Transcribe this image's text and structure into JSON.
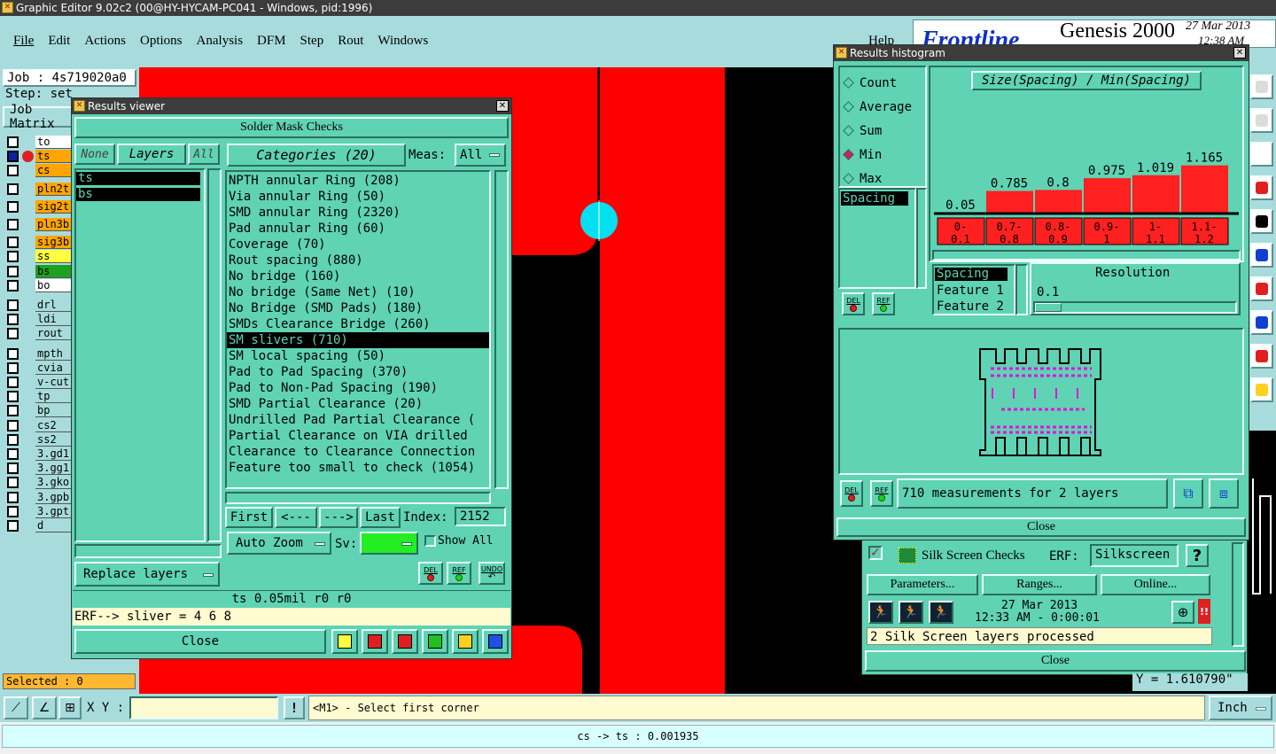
{
  "window": {
    "title": "Graphic Editor 9.02c2 (00@HY-HYCAM-PC041 - Windows, pid:1996)"
  },
  "menu": [
    "File",
    "Edit",
    "Actions",
    "Options",
    "Analysis",
    "DFM",
    "Step",
    "Rout",
    "Windows"
  ],
  "help_label": "Help",
  "brand": {
    "logo": "Frontline",
    "product": "Genesis 2000",
    "date": "27 Mar 2013",
    "time": "12:38 AM"
  },
  "job": {
    "job": "Job : 4s719020a0",
    "step": "Step: set",
    "matrix": "Job Matrix"
  },
  "layers": [
    {
      "name": "to",
      "color": "#ffffff"
    },
    {
      "name": "ts",
      "color": "#ffa500"
    },
    {
      "name": "cs",
      "color": "#ffa500"
    },
    {
      "name": "pln2t",
      "color": "#ffa500"
    },
    {
      "name": "sig2t",
      "color": "#ffa500"
    },
    {
      "name": "pln3b",
      "color": "#ffa500"
    },
    {
      "name": "sig3b",
      "color": "#ffa500"
    },
    {
      "name": "ss",
      "color": "#ffff40"
    },
    {
      "name": "bs",
      "color": "#20a020"
    },
    {
      "name": "bo",
      "color": "#ffffff"
    },
    {
      "name": "drl",
      "color": "#a8dcdc"
    },
    {
      "name": "ldi",
      "color": "#a8dcdc"
    },
    {
      "name": "rout",
      "color": "#a8dcdc"
    },
    {
      "name": "mpth",
      "color": "#a8dcdc"
    },
    {
      "name": "cvia",
      "color": "#a8dcdc"
    },
    {
      "name": "v-cut",
      "color": "#a8dcdc"
    },
    {
      "name": "tp",
      "color": "#a8dcdc"
    },
    {
      "name": "bp",
      "color": "#a8dcdc"
    },
    {
      "name": "cs2",
      "color": "#a8dcdc"
    },
    {
      "name": "ss2",
      "color": "#a8dcdc"
    },
    {
      "name": "3.gd1",
      "color": "#a8dcdc"
    },
    {
      "name": "3.gg1",
      "color": "#a8dcdc"
    },
    {
      "name": "3.gko",
      "color": "#a8dcdc"
    },
    {
      "name": "3.gpb",
      "color": "#a8dcdc"
    },
    {
      "name": "3.gpt",
      "color": "#a8dcdc"
    },
    {
      "name": "d",
      "color": "#a8dcdc"
    }
  ],
  "selected": "Selected : 0",
  "results_viewer": {
    "title": "Results viewer",
    "header": "Solder Mask Checks",
    "none_btn": "None",
    "layers_btn": "Layers",
    "all_btn": "All",
    "layer_list": [
      "ts",
      "bs"
    ],
    "categories_label": "Categories (20)",
    "meas_label": "Meas:",
    "meas_value": "All",
    "categories": [
      "NPTH annular Ring (208)",
      "Via annular Ring (50)",
      "SMD annular Ring (2320)",
      "Pad annular Ring (60)",
      "Coverage (70)",
      "Rout spacing (880)",
      "No bridge (160)",
      "No bridge (Same Net) (10)",
      "No Bridge (SMD Pads) (180)",
      "SMDs Clearance Bridge (260)",
      "SM slivers (710)",
      "SM local spacing (50)",
      "Pad to Pad Spacing (370)",
      "Pad to Non-Pad Spacing (190)",
      "SMD Partial Clearance (20)",
      "Undrilled Pad Partial Clearance (",
      "Partial Clearance on VIA drilled",
      "Clearance to Clearance Connection",
      "Feature too small to check (1054)"
    ],
    "selected_index": 10,
    "nav": {
      "first": "First",
      "prev": "<---",
      "next": "--->",
      "last": "Last",
      "index_label": "Index:",
      "index_value": "2152"
    },
    "auto_zoom": "Auto Zoom",
    "sv_label": "Sv:",
    "show_all": "Show All",
    "replace_layers": "Replace layers",
    "del": "DEL",
    "ref": "REF",
    "undo": "UNDO",
    "status": "ts 0.05mil  r0  r0",
    "erf": "ERF--> sliver = 4 6 8",
    "close": "Close"
  },
  "histogram": {
    "title": "Results histogram",
    "options": [
      "Count",
      "Average",
      "Sum",
      "Min",
      "Max"
    ],
    "selected_option": "Min",
    "chart_title": "Size(Spacing) / Min(Spacing)",
    "attr_list": [
      "Spacing"
    ],
    "bins": [
      "0-\n0.1",
      "0.7-\n0.8",
      "0.8-\n0.9",
      "0.9-\n1",
      "1-\n1.1",
      "1.1-\n1.2"
    ],
    "values": [
      "0.05",
      "0.785",
      "0.8",
      "0.975",
      "1.019",
      "1.165"
    ],
    "sort_list": [
      "Spacing",
      "Feature 1",
      "Feature 2"
    ],
    "resolution_label": "Resolution",
    "resolution_value": "0.1",
    "del": "DEL",
    "ref": "REF",
    "measurements": "710 measurements for 2 layers",
    "close": "Close",
    "bar_color": "#ff2020"
  },
  "chart_data": {
    "type": "bar",
    "title": "Size(Spacing) / Min(Spacing)",
    "categories": [
      "0-0.1",
      "0.7-0.8",
      "0.8-0.9",
      "0.9-1",
      "1-1.1",
      "1.1-1.2"
    ],
    "values": [
      0.05,
      0.785,
      0.8,
      0.975,
      1.019,
      1.165
    ]
  },
  "silk": {
    "title": "Silk Screen Checks",
    "erf_label": "ERF:",
    "erf_value": "Silkscreen",
    "help": "?",
    "parameters": "Parameters...",
    "ranges": "Ranges...",
    "online": "Online...",
    "date": "27 Mar 2013",
    "time": "12:33 AM - 0:00:01",
    "status": "2 Silk Screen layers processed",
    "close": "Close",
    "warn": "!!"
  },
  "coord_y": "Y = 1.610790\"",
  "bottom": {
    "xy_label": "X Y :",
    "xy_value": "",
    "bang": "!",
    "prompt": "<M1> - Select first corner",
    "units": "Inch",
    "status": "cs -> ts : 0.001935"
  }
}
